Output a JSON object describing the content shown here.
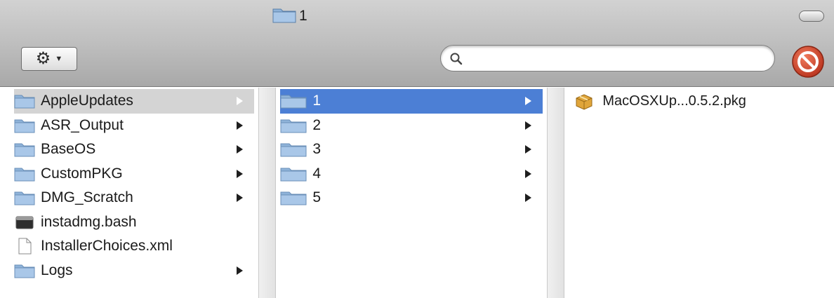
{
  "window": {
    "title": "1",
    "title_icon": "folder-icon"
  },
  "toolbar": {
    "action_menu_icon": "gear-icon",
    "search": {
      "value": "",
      "placeholder": ""
    },
    "stop_icon": "stop-icon"
  },
  "columns": {
    "col1": {
      "items": [
        {
          "label": "AppleUpdates",
          "icon": "folder-icon",
          "has_arrow": true,
          "state": "selected-inactive"
        },
        {
          "label": "ASR_Output",
          "icon": "folder-icon",
          "has_arrow": true
        },
        {
          "label": "BaseOS",
          "icon": "folder-icon",
          "has_arrow": true
        },
        {
          "label": "CustomPKG",
          "icon": "folder-icon",
          "has_arrow": true
        },
        {
          "label": "DMG_Scratch",
          "icon": "folder-icon",
          "has_arrow": true
        },
        {
          "label": "instadmg.bash",
          "icon": "terminal-file-icon",
          "has_arrow": false
        },
        {
          "label": "InstallerChoices.xml",
          "icon": "document-icon",
          "has_arrow": false
        },
        {
          "label": "Logs",
          "icon": "folder-icon",
          "has_arrow": true
        }
      ]
    },
    "col2": {
      "items": [
        {
          "label": "1",
          "icon": "folder-icon",
          "has_arrow": true,
          "state": "selected-active"
        },
        {
          "label": "2",
          "icon": "folder-icon",
          "has_arrow": true
        },
        {
          "label": "3",
          "icon": "folder-icon",
          "has_arrow": true
        },
        {
          "label": "4",
          "icon": "folder-icon",
          "has_arrow": true
        },
        {
          "label": "5",
          "icon": "folder-icon",
          "has_arrow": true
        }
      ]
    },
    "col3": {
      "items": [
        {
          "label": "MacOSXUp...0.5.2.pkg",
          "icon": "package-icon",
          "has_arrow": false
        }
      ]
    }
  },
  "colors": {
    "selection_blue": "#4c7fd5",
    "selection_grey": "#d4d4d4",
    "stop_red": "#d9452b"
  }
}
